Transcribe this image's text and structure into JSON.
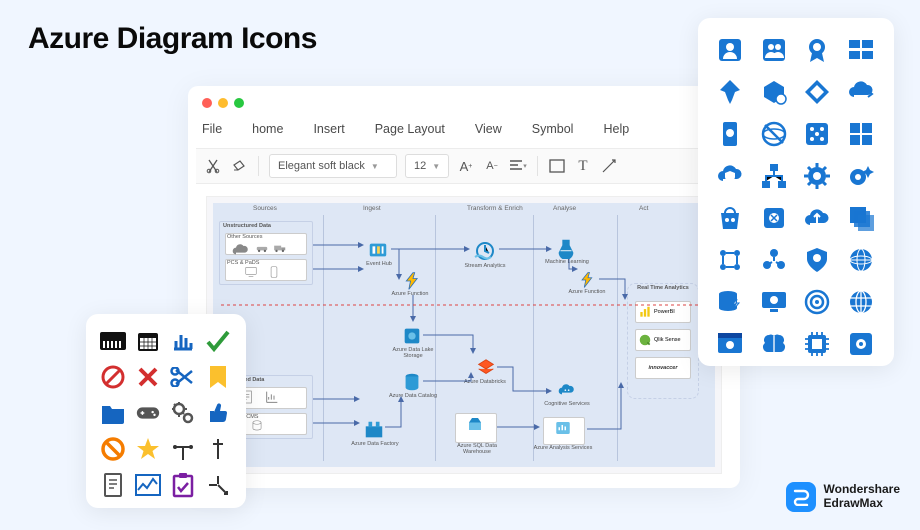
{
  "title": "Azure Diagram Icons",
  "menu": [
    "File",
    "home",
    "Insert",
    "Page Layout",
    "View",
    "Symbol",
    "Help"
  ],
  "toolbar": {
    "font_dropdown": "Elegant soft black",
    "size_dropdown": "12"
  },
  "columns": [
    "Sources",
    "Ingest",
    "Transform & Enrich",
    "Analyse",
    "Act"
  ],
  "diagram": {
    "unstructured_label": "Unstructured Data",
    "other_sources": "Other Sources",
    "pcs_pads": "PCS & PaDS",
    "structured_label": "Structured Data",
    "crm_cms": "CRM & CMS",
    "event_hub": "Event Hub",
    "azure_function": "Azure Function",
    "data_lake_storage": "Azure Data Lake Storage",
    "data_catalog": "Azure Data Catalog",
    "data_factory": "Azure Data Factory",
    "stream_analytics": "Stream Analytics",
    "databricks": "Azure Databricks",
    "sql_data_warehouse": "Azure SQL Data Warehouse",
    "machine_learning": "Machine Learning",
    "azure_function2": "Azure Function",
    "cognitive_services": "Cognitive Services",
    "analysis_services": "Azure Analysis Services",
    "realtime_analytics": "Real Time Analytics",
    "powerbi": "PowerBI",
    "qlik": "Qlik Sense",
    "innovaccer": "innovaccer"
  },
  "logo": {
    "brand": "Wondershare",
    "product": "EdrawMax"
  },
  "colors": {
    "accent": "#1976d2",
    "bg": "#f0f6ff"
  }
}
